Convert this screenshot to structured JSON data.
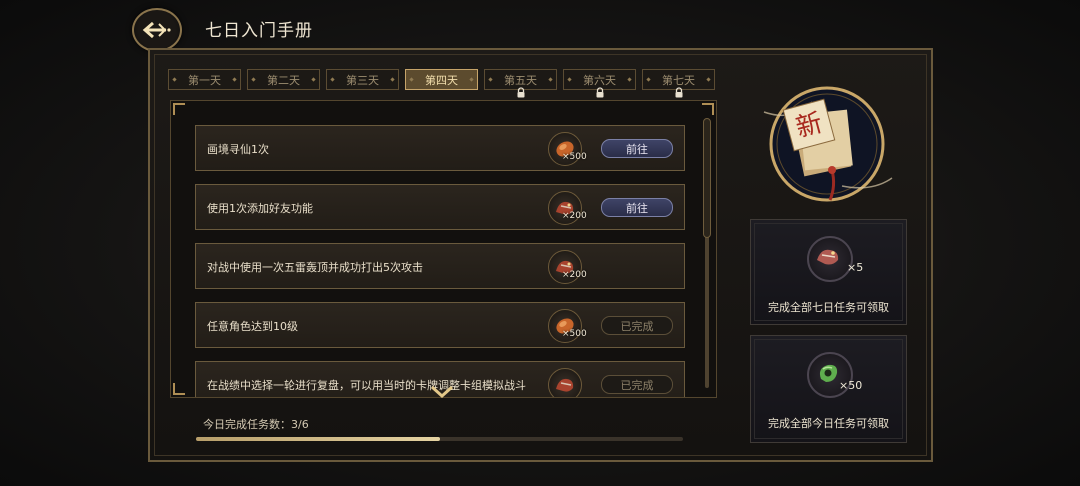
{
  "header": {
    "title": "七日入门手册",
    "back_icon": "back-arrow-icon"
  },
  "tabs": [
    {
      "label": "第一天",
      "active": false,
      "locked": false
    },
    {
      "label": "第二天",
      "active": false,
      "locked": false
    },
    {
      "label": "第三天",
      "active": false,
      "locked": false
    },
    {
      "label": "第四天",
      "active": true,
      "locked": false
    },
    {
      "label": "第五天",
      "active": false,
      "locked": true
    },
    {
      "label": "第六天",
      "active": false,
      "locked": true
    },
    {
      "label": "第七天",
      "active": false,
      "locked": true
    }
  ],
  "tasks": [
    {
      "text": "画境寻仙1次",
      "reward_icon": "bread-icon",
      "reward_count": "×500",
      "button": "前往",
      "state": "go"
    },
    {
      "text": "使用1次添加好友功能",
      "reward_icon": "dragon-icon",
      "reward_count": "×200",
      "button": "前往",
      "state": "go"
    },
    {
      "text": "对战中使用一次五雷轰顶并成功打出5次攻击",
      "reward_icon": "dragon-icon",
      "reward_count": "×200",
      "button": "",
      "state": "none"
    },
    {
      "text": "任意角色达到10级",
      "reward_icon": "bread-icon",
      "reward_count": "×500",
      "button": "已完成",
      "state": "done"
    },
    {
      "text": "在战绩中选择一轮进行复盘，可以用当时的卡牌调整卡组模拟战斗",
      "reward_icon": "dragon-icon",
      "reward_count": "",
      "button": "已完成",
      "state": "done"
    }
  ],
  "progress": {
    "label": "今日完成任务数：3/6",
    "completed": 3,
    "total": 6
  },
  "rewards": {
    "seven_day": {
      "icon": "dragon-card-icon",
      "count": "×5",
      "label": "完成全部七日任务可领取"
    },
    "today": {
      "icon": "jade-icon",
      "count": "×50",
      "label": "完成全部今日任务可领取"
    }
  },
  "medal": {
    "glyph": "新",
    "icon": "new-player-book-icon"
  },
  "colors": {
    "accent": "#c6a46a",
    "go_button": "#3f4467",
    "panel_border": "#6a5a3c"
  }
}
